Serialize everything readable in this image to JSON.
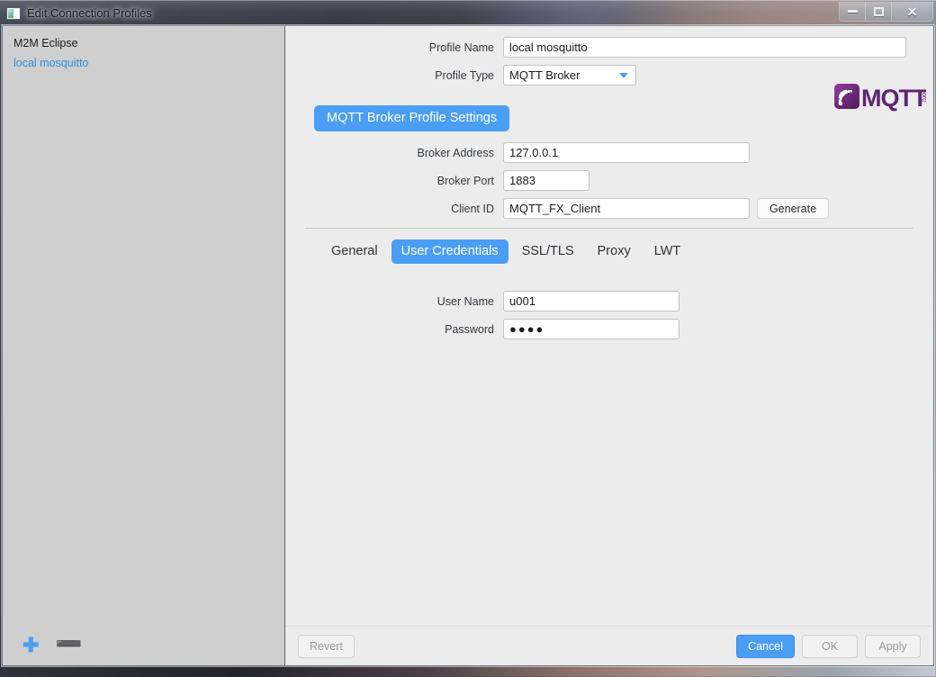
{
  "window": {
    "title": "Edit Connection Profiles",
    "icon": "window-icon",
    "controls": {
      "minimize": "minimize-button",
      "maximize": "maximize-button",
      "close_glyph": "✕"
    }
  },
  "sidebar": {
    "items": [
      {
        "label": "M2M Eclipse",
        "style": "plain"
      },
      {
        "label": "local mosquitto",
        "style": "link"
      }
    ],
    "toolbar": {
      "add_glyph": "✚",
      "remove_glyph": "➖"
    }
  },
  "form": {
    "profile_name": {
      "label": "Profile Name",
      "value": "local mosquitto",
      "placeholder": ""
    },
    "profile_type": {
      "label": "Profile Type",
      "value": "MQTT Broker",
      "options": [
        "MQTT Broker"
      ]
    },
    "section_title": "MQTT Broker Profile Settings",
    "broker_address": {
      "label": "Broker Address",
      "value": "127.0.0.1",
      "placeholder": ""
    },
    "broker_port": {
      "label": "Broker Port",
      "value": "1883",
      "placeholder": ""
    },
    "client_id": {
      "label": "Client ID",
      "value": "MQTT_FX_Client",
      "placeholder": ""
    },
    "generate_label": "Generate"
  },
  "tabs": [
    {
      "label": "General",
      "active": false
    },
    {
      "label": "User Credentials",
      "active": true
    },
    {
      "label": "SSL/TLS",
      "active": false
    },
    {
      "label": "Proxy",
      "active": false
    },
    {
      "label": "LWT",
      "active": false
    }
  ],
  "credentials": {
    "user_name": {
      "label": "User Name",
      "value": "u001",
      "placeholder": ""
    },
    "password": {
      "label": "Password",
      "value": "●●●●",
      "placeholder": ""
    }
  },
  "footer": {
    "revert": "Revert",
    "cancel": "Cancel",
    "ok": "OK",
    "apply": "Apply"
  },
  "logo": {
    "text": "MQTT",
    "suffix": ".org"
  },
  "colors": {
    "accent": "#4a9ef5",
    "link": "#2b8fe0",
    "sidebar_bg": "#cfcfcf",
    "panel_bg": "#ececec",
    "logo_purple": "#6e2a7a"
  }
}
